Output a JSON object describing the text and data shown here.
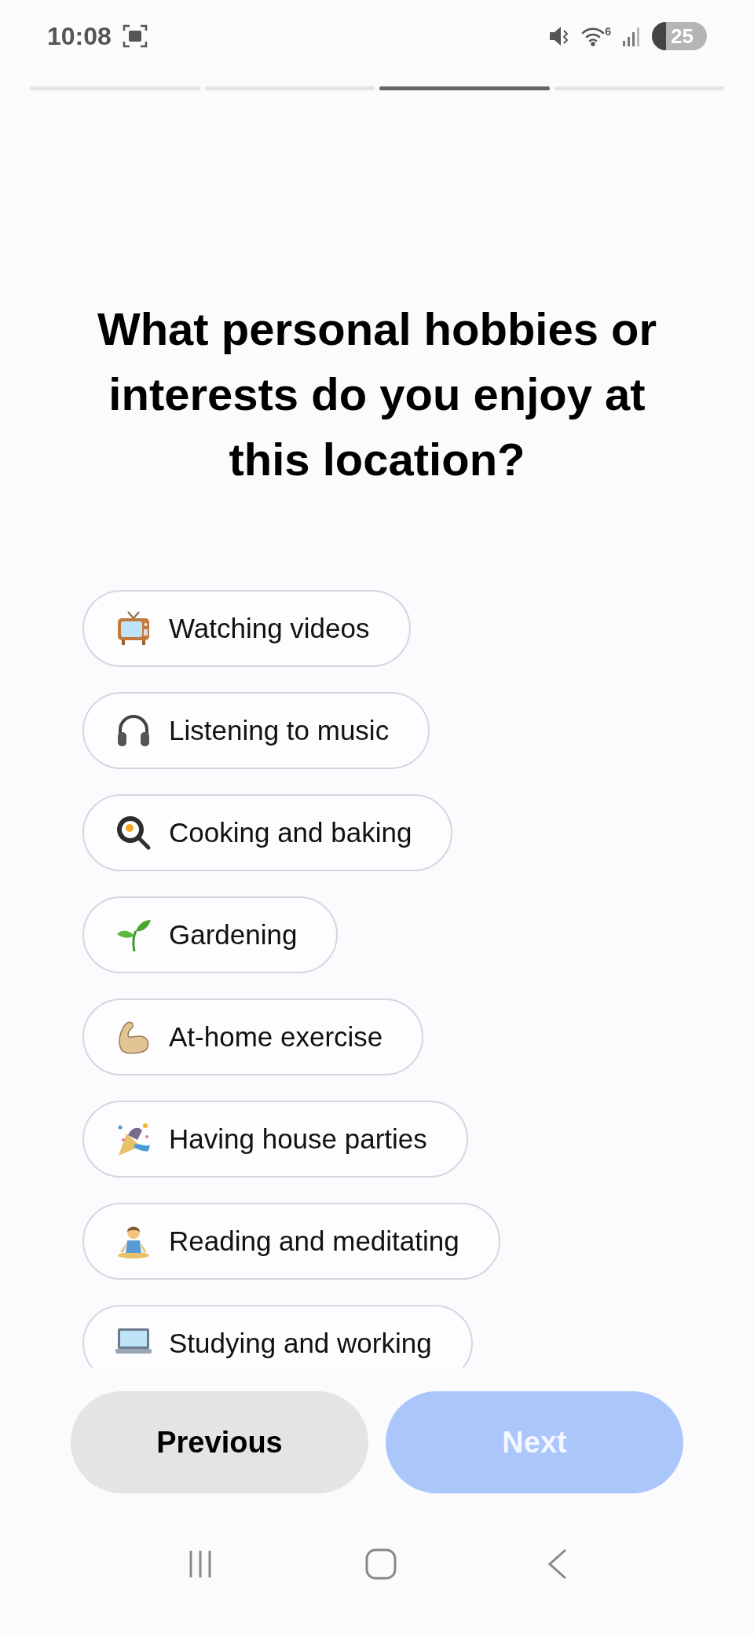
{
  "status_bar": {
    "time": "10:08",
    "wifi_badge": "6",
    "battery": "25"
  },
  "progress": [
    {
      "selected": false
    },
    {
      "selected": false
    },
    {
      "selected": true
    },
    {
      "selected": false
    }
  ],
  "question": "What personal hobbies or interests do you enjoy at this location?",
  "options": [
    {
      "label": "Watching videos",
      "selected": false
    },
    {
      "label": "Listening to music",
      "selected": false
    },
    {
      "label": "Cooking and baking",
      "selected": false
    },
    {
      "label": "Gardening",
      "selected": false
    },
    {
      "label": "At-home exercise",
      "selected": false
    },
    {
      "label": "Having house parties",
      "selected": false
    },
    {
      "label": "Reading and meditating",
      "selected": false
    },
    {
      "label": "Studying and working",
      "selected": false
    }
  ],
  "buttons": [
    {
      "label": "Previous",
      "kind": "secondary",
      "disabled": false
    },
    {
      "label": "Next",
      "kind": "primary",
      "disabled": true
    }
  ]
}
